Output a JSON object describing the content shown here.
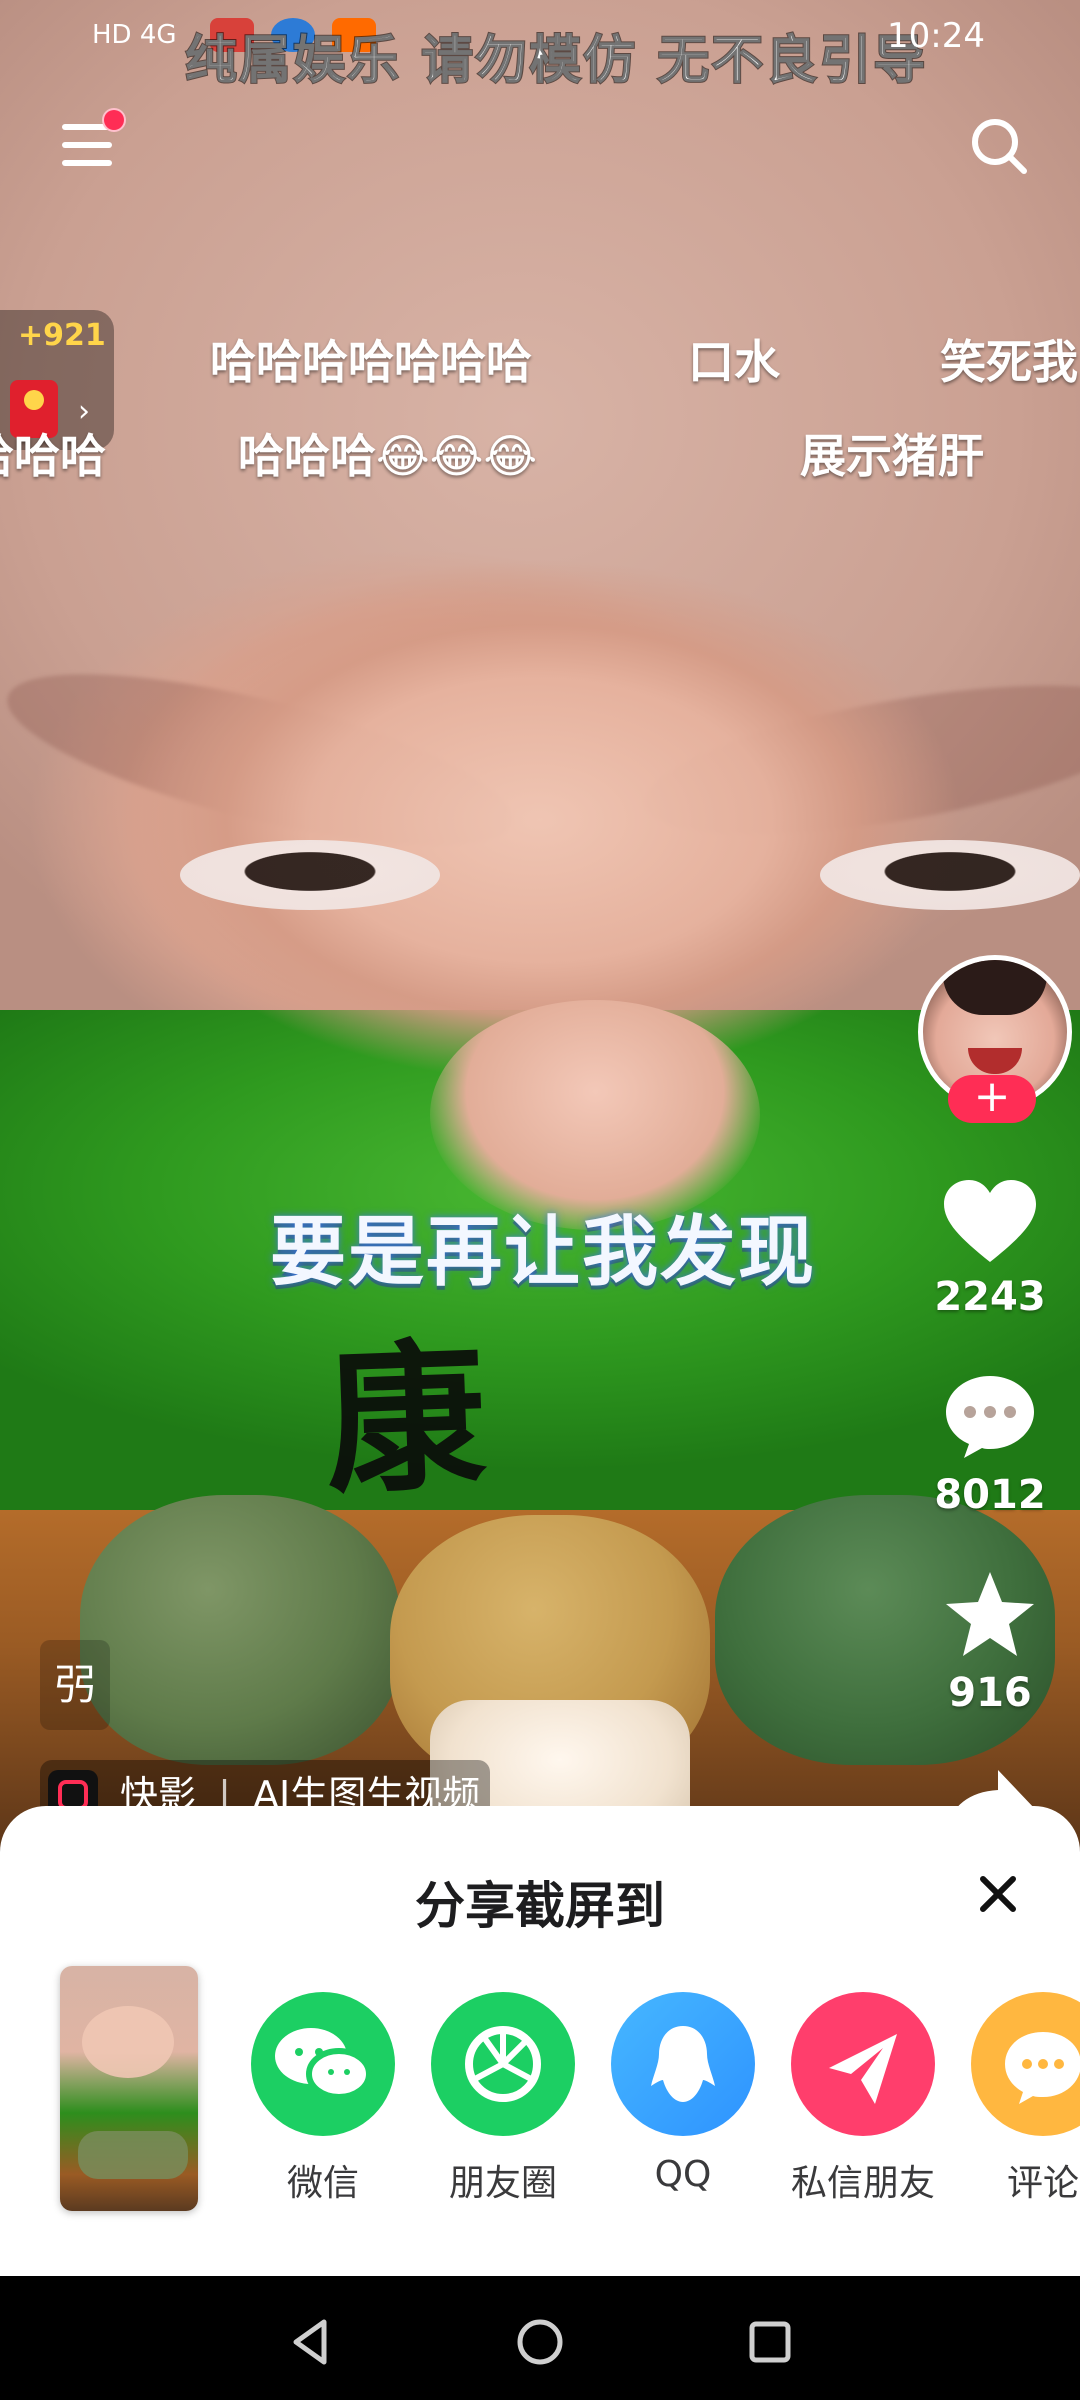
{
  "status_bar": {
    "left_text": "HD 4G",
    "time": "10:24",
    "overlay_text": "纯属娱乐 请勿模仿 无不良引导"
  },
  "top_bar": {
    "menu_icon": "menu-icon",
    "search_icon": "search-icon"
  },
  "reward": {
    "count": "+921",
    "arrow": "›"
  },
  "danmaku": [
    {
      "text": "哈哈哈哈哈哈哈"
    },
    {
      "text": "口水"
    },
    {
      "text": "笑死我"
    },
    {
      "text": "哈哈哈"
    },
    {
      "text": "哈哈哈😂😂😂"
    },
    {
      "text": "展示猪肝"
    }
  ],
  "video": {
    "subtitle": "要是再让我发现",
    "shirt_text": "康",
    "watermark": "弜",
    "source_app": "快影",
    "source_text": "AI生图生视频"
  },
  "rail": {
    "follow_plus": "+",
    "likes": "2243",
    "comments": "8012",
    "favorites": "916"
  },
  "share_sheet": {
    "title": "分享截屏到",
    "close_icon": "close-icon",
    "targets": [
      {
        "label": "微信",
        "color": "#1ccf63",
        "icon": "wechat-icon"
      },
      {
        "label": "朋友圈",
        "color": "#1ccf63",
        "icon": "moments-icon"
      },
      {
        "label": "QQ",
        "color": "#3aa7ff",
        "icon": "qq-icon"
      },
      {
        "label": "私信朋友",
        "color": "#ff3e6c",
        "icon": "send-icon"
      },
      {
        "label": "评论",
        "color": "#ffb740",
        "icon": "comment-icon"
      }
    ]
  },
  "nav": {
    "back_icon": "back-icon",
    "home_icon": "home-icon",
    "recent_icon": "recent-apps-icon"
  }
}
